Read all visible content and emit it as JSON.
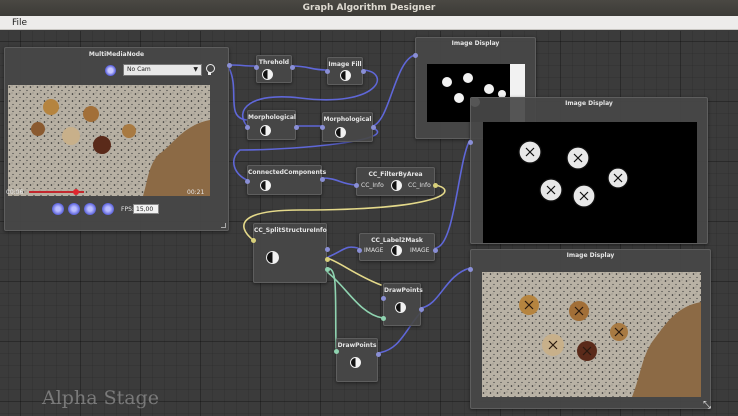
{
  "window": {
    "title": "Graph Algorithm Designer"
  },
  "menu": {
    "file": "File"
  },
  "multimedia_node": {
    "title": "MultiMediaNode",
    "camera_select": "No Cam",
    "time_elapsed": "00:06",
    "time_total": "00:21",
    "fps_label": "FPS:",
    "fps_value": "15,00"
  },
  "nodes": {
    "threshold": "Threhold",
    "image_fill": "Image Fill",
    "morphological_1": "Morphological",
    "morphological_2": "Morphological",
    "connected_components": "ConnectedComponents",
    "cc_filter_by_area": {
      "title": "CC_FilterByArea",
      "in": "CC_Info",
      "out": "CC_Info"
    },
    "cc_split_structure_info": "CC_SplitStructureInfo",
    "cc_label2mask": {
      "title": "CC_Label2Mask",
      "in": "IMAGE",
      "out": "IMAGE"
    },
    "draw_points_1": "DrawPoints",
    "draw_points_2": "DrawPoints"
  },
  "image_displays": [
    {
      "title": "Image Display"
    },
    {
      "title": "Image Display"
    },
    {
      "title": "Image Display"
    }
  ],
  "watermark": "Alpha Stage",
  "colors": {
    "wire_blue": "#5f67d8",
    "wire_yellow": "#e4d98a",
    "wire_green": "#8fd3b0",
    "seek_red": "#c2272d"
  },
  "icons": [
    "camera-icon",
    "lightbulb-icon",
    "play-icon",
    "pause-icon",
    "stop-icon",
    "loop-icon",
    "half-circle-icon",
    "resize-icon"
  ]
}
